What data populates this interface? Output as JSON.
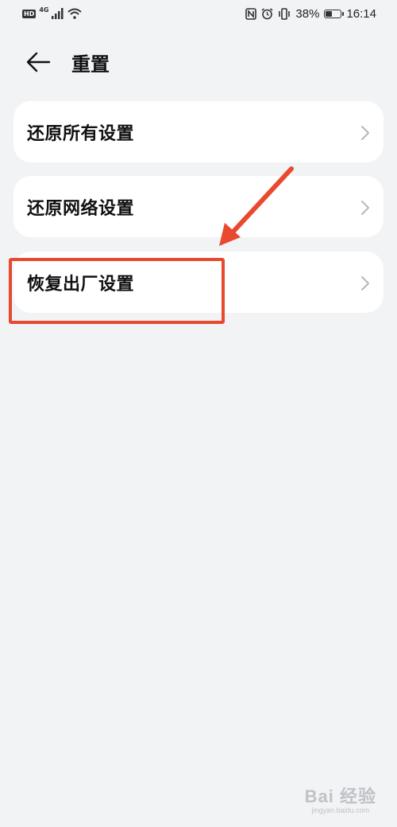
{
  "status_bar": {
    "left_badge": "HD",
    "network": "4G",
    "battery_percent": "38%",
    "battery_level": 0.38,
    "time": "16:14",
    "icons": [
      "hd-icon",
      "signal-icon",
      "wifi-icon",
      "nfc-icon",
      "alarm-icon",
      "vibrate-icon",
      "battery-icon"
    ]
  },
  "header": {
    "title": "重置",
    "back_icon": "arrow-left-icon"
  },
  "items": [
    {
      "label": "还原所有设置",
      "chevron": "chevron-right-icon"
    },
    {
      "label": "还原网络设置",
      "chevron": "chevron-right-icon"
    },
    {
      "label": "恢复出厂设置",
      "chevron": "chevron-right-icon"
    }
  ],
  "annotation": {
    "color": "#e8492f",
    "highlighted_item": "恢复出厂设置"
  },
  "watermark": {
    "text": "Bai 经验",
    "url": "jingyan.baidu.com"
  }
}
